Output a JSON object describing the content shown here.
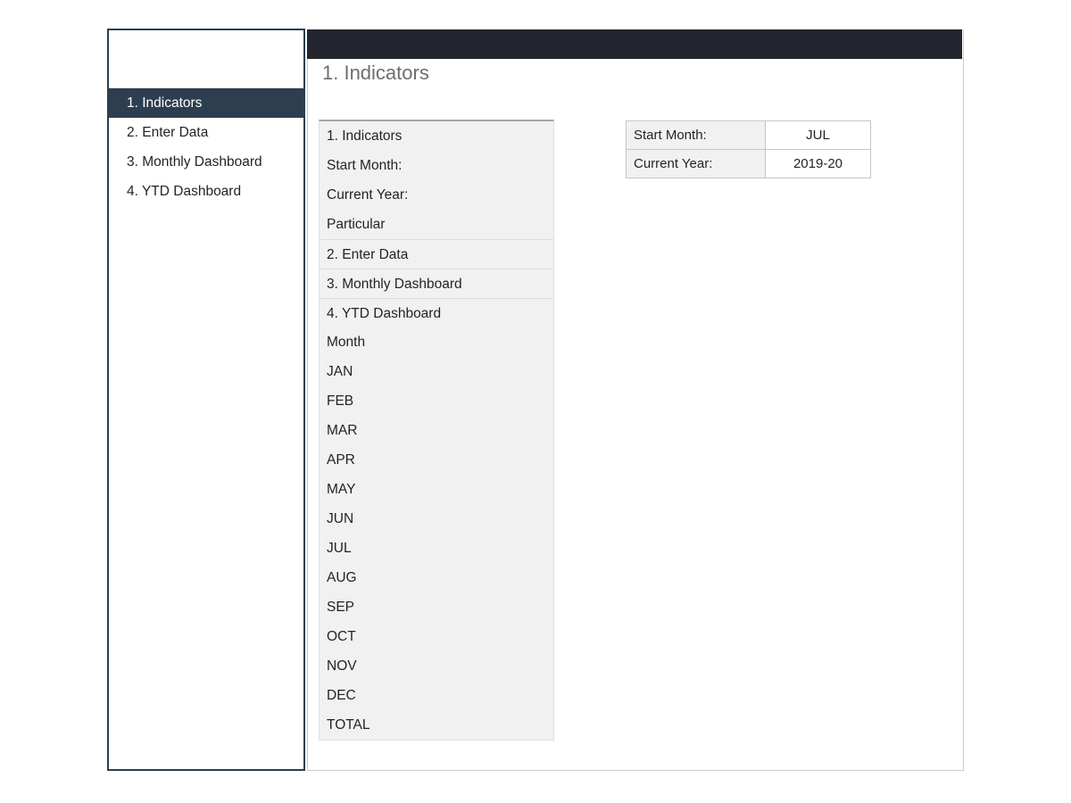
{
  "window": {
    "topbar_color": "#23262f",
    "accent_color": "#2d3e50"
  },
  "sidebar": {
    "logo_label": "",
    "items": [
      {
        "label": "1. Indicators",
        "active": true
      },
      {
        "label": "2. Enter Data",
        "active": false
      },
      {
        "label": "3. Monthly Dashboard",
        "active": false
      },
      {
        "label": "4. YTD Dashboard",
        "active": false
      }
    ]
  },
  "main": {
    "page_title": "1. Indicators",
    "label_list": [
      {
        "text": "1. Indicators",
        "separator": false
      },
      {
        "text": "Start Month:",
        "separator": false
      },
      {
        "text": "Current Year:",
        "separator": false
      },
      {
        "text": "Particular",
        "separator": false
      },
      {
        "text": "2. Enter Data",
        "separator": true
      },
      {
        "text": "3. Monthly Dashboard",
        "separator": true
      },
      {
        "text": "4. YTD Dashboard",
        "separator": true
      },
      {
        "text": "Month",
        "separator": false
      },
      {
        "text": "JAN",
        "separator": false
      },
      {
        "text": "FEB",
        "separator": false
      },
      {
        "text": "MAR",
        "separator": false
      },
      {
        "text": "APR",
        "separator": false
      },
      {
        "text": "MAY",
        "separator": false
      },
      {
        "text": "JUN",
        "separator": false
      },
      {
        "text": "JUL",
        "separator": false
      },
      {
        "text": "AUG",
        "separator": false
      },
      {
        "text": "SEP",
        "separator": false
      },
      {
        "text": "OCT",
        "separator": false
      },
      {
        "text": "NOV",
        "separator": false
      },
      {
        "text": "DEC",
        "separator": false
      },
      {
        "text": "TOTAL",
        "separator": false
      }
    ],
    "settings_table": {
      "rows": [
        {
          "key": "Start Month:",
          "value": "JUL"
        },
        {
          "key": "Current Year:",
          "value": "2019-20"
        }
      ]
    }
  }
}
